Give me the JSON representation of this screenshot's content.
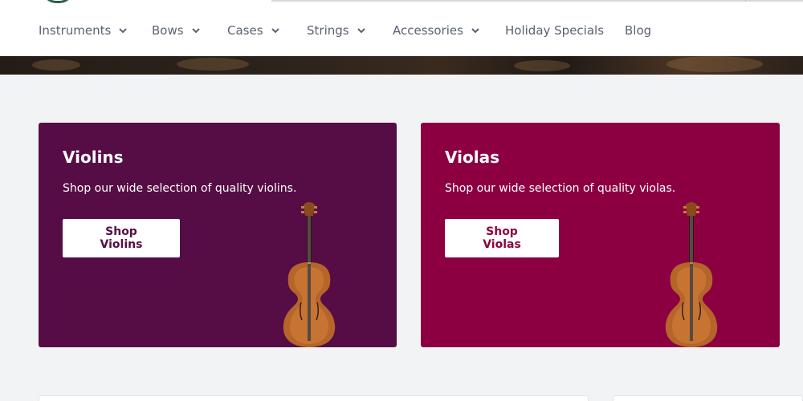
{
  "nav": {
    "items": [
      {
        "label": "Instruments",
        "has_dropdown": true
      },
      {
        "label": "Bows",
        "has_dropdown": true
      },
      {
        "label": "Cases",
        "has_dropdown": true
      },
      {
        "label": "Strings",
        "has_dropdown": true
      },
      {
        "label": "Accessories",
        "has_dropdown": true
      },
      {
        "label": "Holiday Specials",
        "has_dropdown": false
      },
      {
        "label": "Blog",
        "has_dropdown": false
      }
    ]
  },
  "cards": [
    {
      "title": "Violins",
      "description": "Shop our wide selection of quality violins.",
      "button_label": "Shop Violins",
      "background": "#560d45",
      "image_icon": "violin-icon"
    },
    {
      "title": "Violas",
      "description": "Shop our wide selection of quality violas.",
      "button_label": "Shop Violas",
      "background": "#8c0042",
      "image_icon": "viola-icon"
    }
  ],
  "colors": {
    "page_background": "#f2f3f5",
    "nav_text": "#5a6270",
    "button_background": "#ffffff"
  }
}
